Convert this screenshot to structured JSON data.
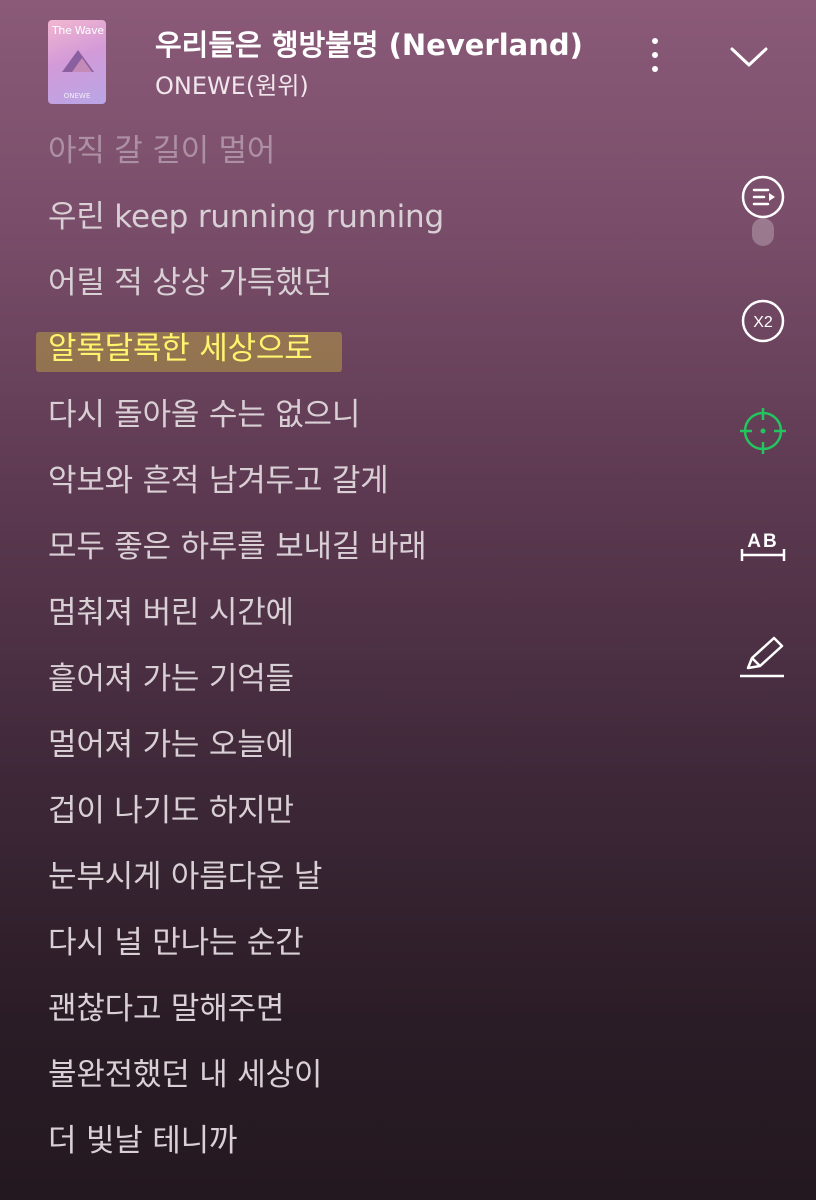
{
  "header": {
    "album_art_title": "The Wave",
    "album_art_footer": "ONEWE",
    "song_title": "우리들은 행방불명 (Neverland)",
    "artist": "ONEWE(원위)",
    "more_icon": "more-vertical-icon",
    "close_icon": "chevron-down-icon"
  },
  "lyrics": {
    "active_index": 3,
    "lines": [
      "아직 갈 길이 멀어",
      "우린 keep running running",
      "어릴 적 상상 가득했던",
      "알록달록한 세상으로",
      "다시 돌아올 수는 없으니",
      "악보와 흔적 남겨두고 갈게",
      "모두 좋은 하루를 보내길 바래",
      "멈춰져 버린 시간에",
      "흩어져 가는 기억들",
      "멀어져 가는 오늘에",
      "겁이 나기도 하지만",
      "눈부시게 아름다운 날",
      "다시 널 만나는 순간",
      "괜찮다고 말해주면",
      "불완전했던 내 세상이",
      "더 빛날 테니까"
    ]
  },
  "side_controls": {
    "playlist_icon": "playlist-icon",
    "speed_label": "X2",
    "sync_icon": "crosshair-icon",
    "ab_label": "AB",
    "edit_icon": "pen-edit-icon",
    "sync_color": "#22c55e"
  },
  "colors": {
    "active_lyric": "#fff46e",
    "highlight": "#d6c23c"
  }
}
